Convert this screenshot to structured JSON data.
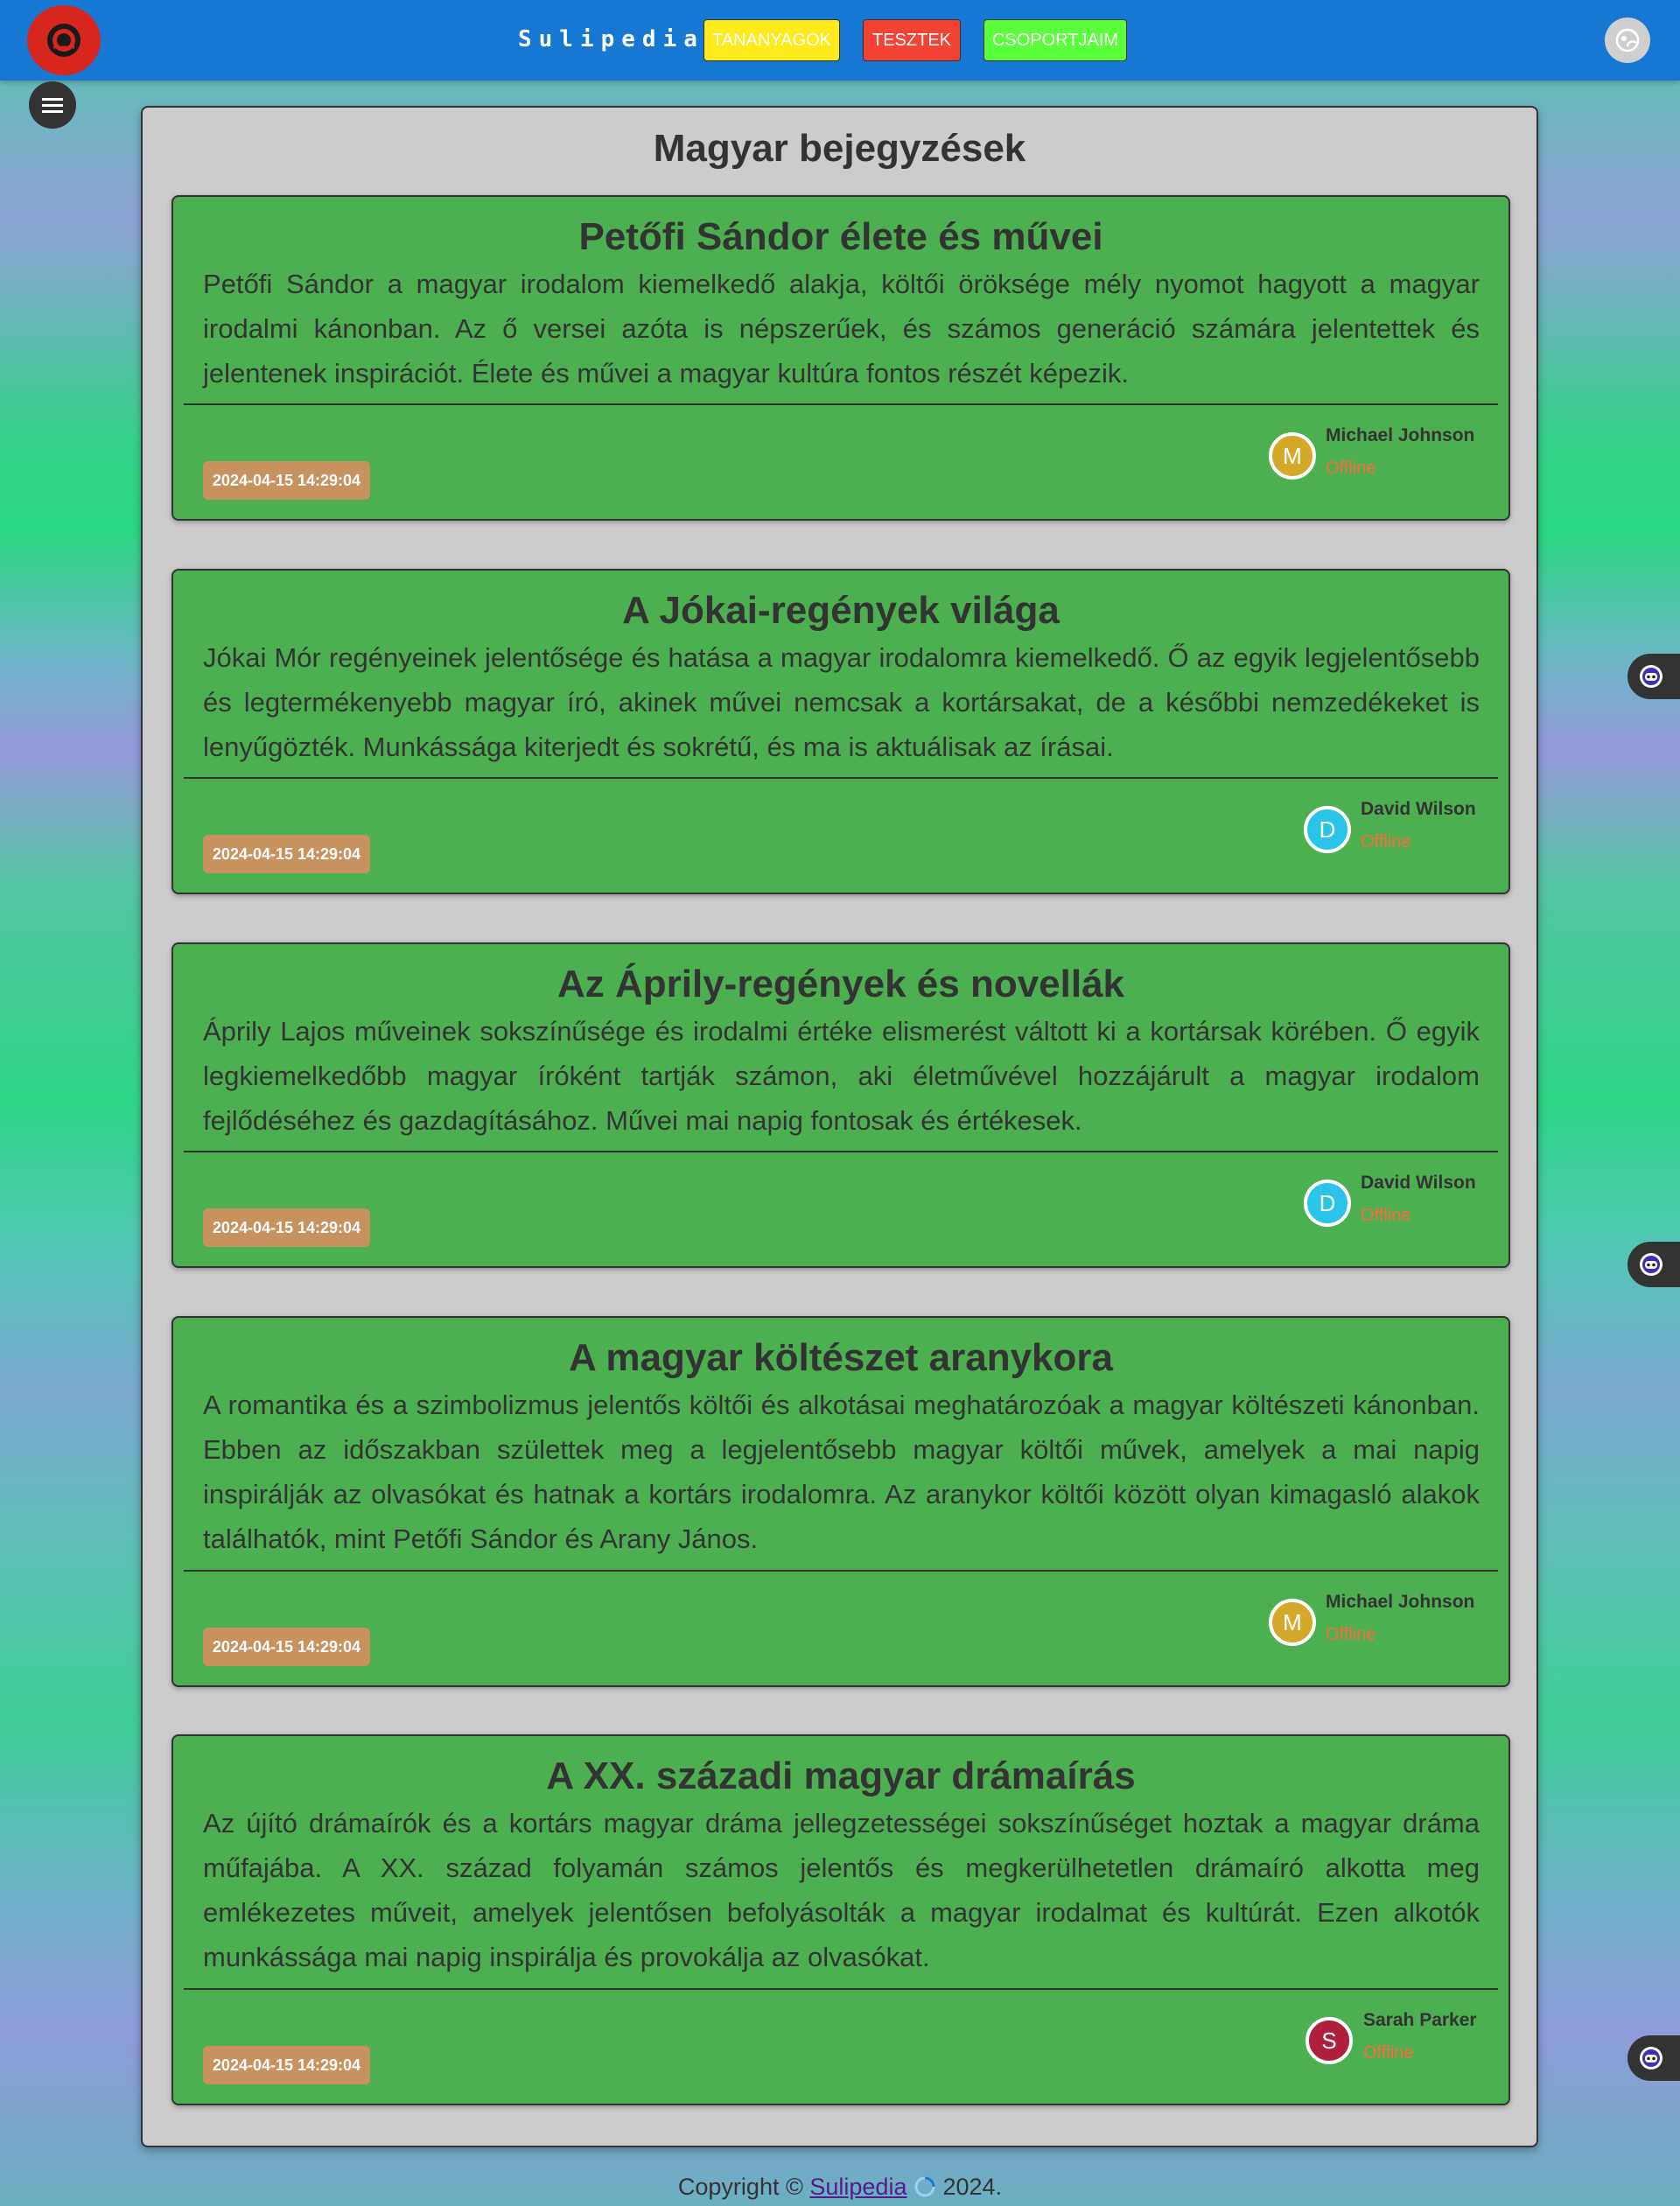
{
  "header": {
    "brand": "Sulipedia",
    "nav": [
      {
        "label": "TANANYAGOK",
        "color": "#ffeb1c"
      },
      {
        "label": "TESZTEK",
        "color": "#f44336"
      },
      {
        "label": "CSOPORTJAIM",
        "color": "#59ff3a"
      }
    ]
  },
  "main": {
    "title": "Magyar bejegyzések",
    "posts": [
      {
        "title": "Petőfi Sándor élete és művei",
        "text": "Petőfi Sándor a magyar irodalom kiemelkedő alakja, költői öröksége mély nyomot hagyott a magyar irodalmi kánonban. Az ő versei azóta is népszerűek, és számos generáció számára jelentettek és jelentenek inspirációt. Élete és művei a magyar kultúra fontos részét képezik.",
        "date": "2024-04-15 14:29:04",
        "author": {
          "initial": "M",
          "name": "Michael Johnson",
          "status": "Offline",
          "color": "#d4a82a"
        }
      },
      {
        "title": "A Jókai-regények világa",
        "text": "Jókai Mór regényeinek jelentősége és hatása a magyar irodalomra kiemelkedő. Ő az egyik legjelentősebb és legtermékenyebb magyar író, akinek művei nemcsak a kortársakat, de a későbbi nemzedékeket is lenyűgözték. Munkássága kiterjedt és sokrétű, és ma is aktuálisak az írásai.",
        "date": "2024-04-15 14:29:04",
        "author": {
          "initial": "D",
          "name": "David Wilson",
          "status": "Offline",
          "color": "#29c4e8"
        }
      },
      {
        "title": "Az Áprily-regények és novellák",
        "text": "Áprily Lajos műveinek sokszínűsége és irodalmi értéke elismerést váltott ki a kortársak körében. Ő egyik legkiemelkedőbb magyar íróként tartják számon, aki életművével hozzájárult a magyar irodalom fejlődéséhez és gazdagításához. Művei mai napig fontosak és értékesek.",
        "date": "2024-04-15 14:29:04",
        "author": {
          "initial": "D",
          "name": "David Wilson",
          "status": "Offline",
          "color": "#29c4e8"
        }
      },
      {
        "title": "A magyar költészet aranykora",
        "text": "A romantika és a szimbolizmus jelentős költői és alkotásai meghatározóak a magyar költészeti kánonban. Ebben az időszakban születtek meg a legjelentősebb magyar költői művek, amelyek a mai napig inspirálják az olvasókat és hatnak a kortárs irodalomra. Az aranykor költői között olyan kimagasló alakok találhatók, mint Petőfi Sándor és Arany János.",
        "date": "2024-04-15 14:29:04",
        "author": {
          "initial": "M",
          "name": "Michael Johnson",
          "status": "Offline",
          "color": "#d4a82a"
        }
      },
      {
        "title": "A XX. századi magyar drámaírás",
        "text": "Az újító drámaírók és a kortárs magyar dráma jellegzetességei sokszínűséget hoztak a magyar dráma műfajába. A XX. század folyamán számos jelentős és megkerülhetetlen drámaíró alkotta meg emlékezetes műveit, amelyek jelentősen befolyásolták a magyar irodalmat és kultúrát. Ezen alkotók munkássága mai napig inspirálja és provokálja az olvasókat.",
        "date": "2024-04-15 14:29:04",
        "author": {
          "initial": "S",
          "name": "Sarah Parker",
          "status": "Offline",
          "color": "#b0203a"
        }
      }
    ]
  },
  "footer": {
    "prefix": "Copyright ©",
    "link": "Sulipedia",
    "suffix": "2024."
  }
}
